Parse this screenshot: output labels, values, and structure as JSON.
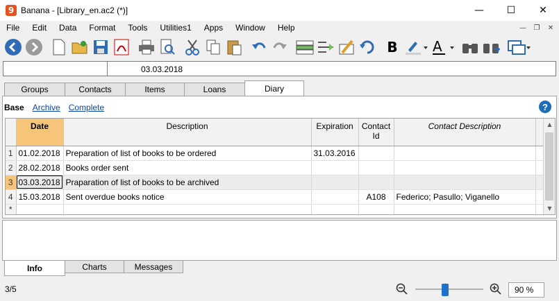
{
  "window": {
    "title": "Banana - [Library_en.ac2 (*)]",
    "app_icon_glyph": "9",
    "controls": {
      "minimize": "—",
      "maximize": "☐",
      "close": "✕"
    }
  },
  "menu": {
    "items": [
      "File",
      "Edit",
      "Data",
      "Format",
      "Tools",
      "Utilities1",
      "Apps",
      "Window",
      "Help"
    ],
    "mdi": {
      "minimize": "—",
      "restore": "❐",
      "close": "✕"
    }
  },
  "toolbar": {
    "icons": [
      "back-icon",
      "forward-icon",
      "new-file-icon",
      "open-folder-icon",
      "save-icon",
      "pdf-icon",
      "print-icon",
      "print-preview-icon",
      "cut-icon",
      "copy-icon",
      "paste-icon",
      "undo-icon",
      "redo-icon",
      "add-row-icon",
      "insert-rows-icon",
      "edit-cell-icon",
      "recheck-icon",
      "bold-icon",
      "highlight-color-icon",
      "text-color-icon",
      "find-icon",
      "find-next-icon",
      "window-switch-icon"
    ],
    "bold_label": "B",
    "text_color_label": "A"
  },
  "formula_bar": {
    "value": "03.03.2018"
  },
  "tabs": [
    "Groups",
    "Contacts",
    "Items",
    "Loans",
    "Diary"
  ],
  "active_tab": "Diary",
  "views": {
    "base": "Base",
    "archive": "Archive",
    "complete": "Complete"
  },
  "help_label": "?",
  "table": {
    "columns": [
      "Date",
      "Description",
      "Expiration",
      "Contact Id",
      "Contact Description"
    ],
    "rows": [
      {
        "num": "1",
        "date": "01.02.2018",
        "description": "Preparation of list of books to be ordered",
        "expiration": "31.03.2016",
        "contact_id": "",
        "contact_desc": ""
      },
      {
        "num": "2",
        "date": "28.02.2018",
        "description": "Books order sent",
        "expiration": "",
        "contact_id": "",
        "contact_desc": ""
      },
      {
        "num": "3",
        "date": "03.03.2018",
        "description": "Praparation of list of books to be archived",
        "expiration": "",
        "contact_id": "",
        "contact_desc": ""
      },
      {
        "num": "4",
        "date": "15.03.2018",
        "description": "Sent overdue books notice",
        "expiration": "",
        "contact_id": "A108",
        "contact_desc": "Federico; Pasullo; Viganello"
      },
      {
        "num": "*",
        "date": "",
        "description": "",
        "expiration": "",
        "contact_id": "",
        "contact_desc": ""
      }
    ]
  },
  "bottom_tabs": [
    "Info",
    "Charts",
    "Messages"
  ],
  "status": {
    "position": "3/5",
    "zoom": "90 %",
    "zoom_level": 0.45,
    "zoom_out": "−",
    "zoom_in": "+"
  },
  "colors": {
    "accent": "#f6c57a",
    "link": "#0645ad",
    "help": "#1e6bb8",
    "slider": "#1e73c8"
  }
}
